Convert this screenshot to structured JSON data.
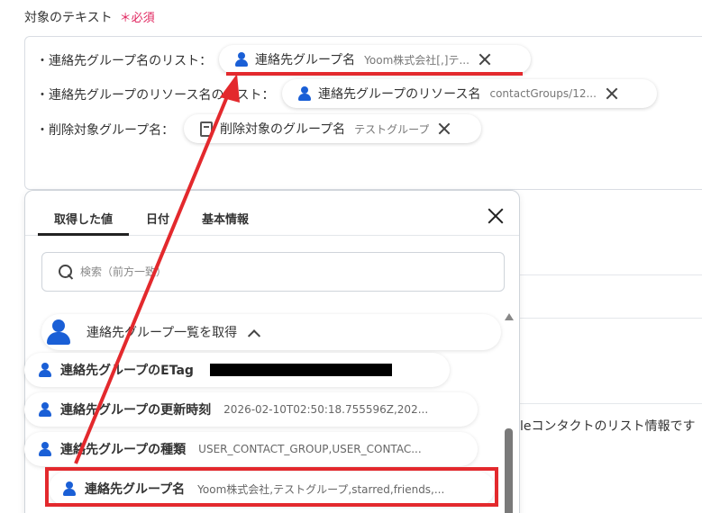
{
  "field": {
    "label": "対象のテキスト",
    "required": "＊必須",
    "lines": [
      {
        "prefix": "・連絡先グループ名のリスト：",
        "chip_name": "連絡先グループ名",
        "chip_value": "Yoom株式会社[,]テ..."
      },
      {
        "prefix": "・連絡先グループのリソース名のリスト：",
        "chip_name": "連絡先グループのリソース名",
        "chip_value": "contactGroups/12..."
      },
      {
        "prefix": "・削除対象グループ名：",
        "chip_name": "削除対象のグループ名",
        "chip_value": "テストグループ"
      }
    ]
  },
  "background_text": "leコンタクトのリスト情報です",
  "panel": {
    "tabs": [
      "取得した値",
      "日付",
      "基本情報"
    ],
    "active_tab": "取得した値",
    "search_placeholder": "検索（前方一致）",
    "group_title": "連絡先グループ一覧を取得",
    "items": [
      {
        "name": "連絡先グループのETag",
        "value": ""
      },
      {
        "name": "連絡先グループの更新時刻",
        "value": "2026-02-10T02:50:18.755596Z,202..."
      },
      {
        "name": "連絡先グループの種類",
        "value": "USER_CONTACT_GROUP,USER_CONTAC..."
      },
      {
        "name": "連絡先グループ名",
        "value": "Yoom株式会社,テストグループ,starred,friends,..."
      }
    ]
  },
  "colors": {
    "accent": "#1a5fd6",
    "highlight": "#e3292d",
    "required": "#e0245e"
  }
}
